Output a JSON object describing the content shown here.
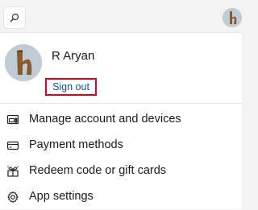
{
  "top": {
    "search_icon": "search-icon",
    "avatar_icon": "avatar"
  },
  "profile": {
    "name": "R Aryan",
    "sign_out_label": "Sign out"
  },
  "menu": {
    "items": [
      {
        "label": "Manage account and devices",
        "icon": "account-devices-icon"
      },
      {
        "label": "Payment methods",
        "icon": "credit-card-icon"
      },
      {
        "label": "Redeem code or gift cards",
        "icon": "gift-icon"
      },
      {
        "label": "App settings",
        "icon": "gear-icon"
      }
    ]
  },
  "colors": {
    "highlight_border": "#e0001b",
    "link": "#1a4fa8"
  }
}
